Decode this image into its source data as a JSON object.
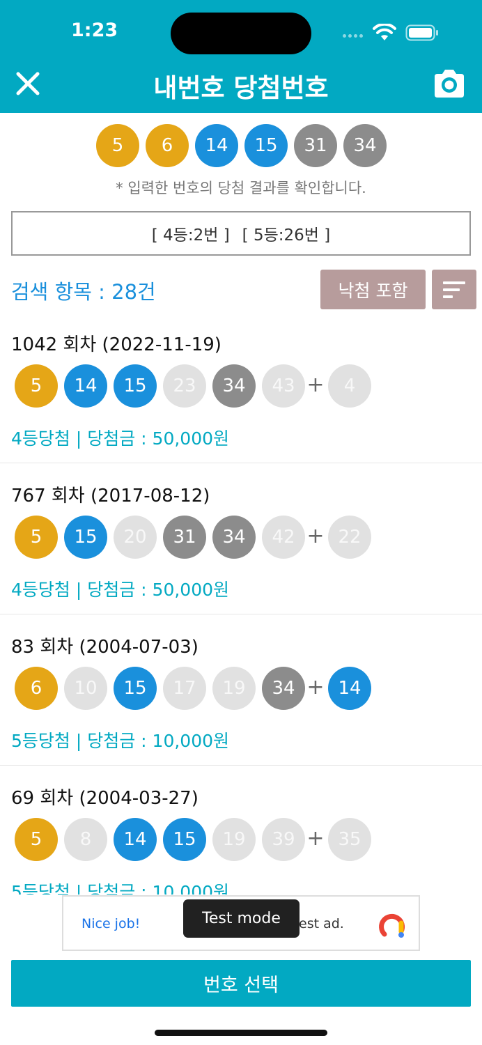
{
  "status": {
    "time": "1:23"
  },
  "header": {
    "title": "내번호 당첨번호"
  },
  "my_numbers": [
    {
      "n": "5",
      "color": "yellow"
    },
    {
      "n": "6",
      "color": "yellow"
    },
    {
      "n": "14",
      "color": "blue"
    },
    {
      "n": "15",
      "color": "blue"
    },
    {
      "n": "31",
      "color": "dgray"
    },
    {
      "n": "34",
      "color": "dgray"
    }
  ],
  "hint": "* 입력한 번호의 당첨 결과를 확인합니다.",
  "summary": {
    "rank4": "[ 4등:2번 ]",
    "rank5": "[ 5등:26번 ]"
  },
  "search": {
    "count_label": "검색 항목 : 28건",
    "include_lose_label": "낙첨 포함"
  },
  "results": [
    {
      "title": "1042 회차 (2022-11-19)",
      "balls": [
        {
          "n": "5",
          "color": "yellow"
        },
        {
          "n": "14",
          "color": "blue"
        },
        {
          "n": "15",
          "color": "blue"
        },
        {
          "n": "23",
          "color": "lgray"
        },
        {
          "n": "34",
          "color": "dgray"
        },
        {
          "n": "43",
          "color": "lgray"
        }
      ],
      "bonus": {
        "n": "4",
        "color": "lgray"
      },
      "prize": "4등당첨 |  당첨금 : 50,000원"
    },
    {
      "title": "767 회차 (2017-08-12)",
      "balls": [
        {
          "n": "5",
          "color": "yellow"
        },
        {
          "n": "15",
          "color": "blue"
        },
        {
          "n": "20",
          "color": "lgray"
        },
        {
          "n": "31",
          "color": "dgray"
        },
        {
          "n": "34",
          "color": "dgray"
        },
        {
          "n": "42",
          "color": "lgray"
        }
      ],
      "bonus": {
        "n": "22",
        "color": "lgray"
      },
      "prize": "4등당첨 |  당첨금 : 50,000원"
    },
    {
      "title": "83 회차 (2004-07-03)",
      "balls": [
        {
          "n": "6",
          "color": "yellow"
        },
        {
          "n": "10",
          "color": "lgray"
        },
        {
          "n": "15",
          "color": "blue"
        },
        {
          "n": "17",
          "color": "lgray"
        },
        {
          "n": "19",
          "color": "lgray"
        },
        {
          "n": "34",
          "color": "dgray"
        }
      ],
      "bonus": {
        "n": "14",
        "color": "blue"
      },
      "prize": "5등당첨 |  당첨금 : 10,000원"
    },
    {
      "title": "69 회차 (2004-03-27)",
      "balls": [
        {
          "n": "5",
          "color": "yellow"
        },
        {
          "n": "8",
          "color": "lgray"
        },
        {
          "n": "14",
          "color": "blue"
        },
        {
          "n": "15",
          "color": "blue"
        },
        {
          "n": "19",
          "color": "lgray"
        },
        {
          "n": "39",
          "color": "lgray"
        }
      ],
      "bonus": {
        "n": "35",
        "color": "lgray"
      },
      "prize": "5등당첨 |  당첨금 : 10,000원"
    }
  ],
  "ad": {
    "nice": "Nice job!",
    "test": "est ad.",
    "toast": "Test mode"
  },
  "footer": {
    "select_label": "번호 선택"
  },
  "colors": {
    "accent": "#02a9c2",
    "yellow": "#e5a617",
    "blue": "#1a90dc",
    "dgray": "#8c8c8c",
    "lgray": "#e1e1e1"
  }
}
